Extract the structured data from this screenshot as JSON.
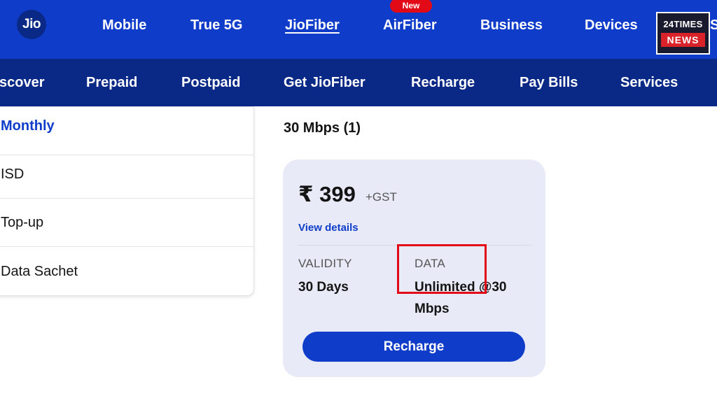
{
  "brand": {
    "logo_text": "Jio",
    "primary_color": "#0f3cc9",
    "dark_color": "#0a2885"
  },
  "top_nav": {
    "items": [
      "Mobile",
      "True 5G",
      "JioFiber",
      "AirFiber",
      "Business",
      "Devices"
    ],
    "active": "JioFiber",
    "new_badge": "New",
    "overflow": "S"
  },
  "watermark": {
    "top": "24TIMES",
    "bottom": "NEWS"
  },
  "sub_nav": {
    "items": [
      "scover",
      "Prepaid",
      "Postpaid",
      "Get JioFiber",
      "Recharge",
      "Pay Bills",
      "Services"
    ]
  },
  "side_menu": {
    "items": [
      "Monthly",
      "ISD",
      "Top-up",
      "Data Sachet"
    ],
    "active": "Monthly"
  },
  "section": {
    "title": "30 Mbps (1)"
  },
  "plan_card": {
    "price": "₹ 399",
    "gst": "+GST",
    "view_details": "View details",
    "validity_label": "VALIDITY",
    "validity_value": "30 Days",
    "data_label": "DATA",
    "data_value_line1": "Unlimited @30",
    "data_value_line2": "Mbps",
    "highlight_color": "#e30a17",
    "button_label": "Recharge"
  }
}
